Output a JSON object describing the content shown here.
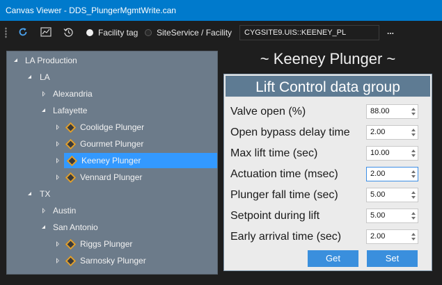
{
  "window": {
    "title": "Canvas Viewer - DDS_PlungerMgmtWrite.can"
  },
  "toolbar": {
    "refresh_icon": "refresh-icon",
    "chart_icon": "chart-icon",
    "history_icon": "history-icon",
    "radio_facility_tag": "Facility tag",
    "radio_site_service": "SiteService / Facility",
    "selected_radio": "Facility tag",
    "tag_path": "CYGSITE9.UIS::KEENEY_PL",
    "browse_label": "..."
  },
  "tree": {
    "nodes": [
      {
        "label": "LA Production",
        "expanded": true
      },
      {
        "label": "LA",
        "expanded": true
      },
      {
        "label": "Alexandria",
        "expanded": false
      },
      {
        "label": "Lafayette",
        "expanded": true
      },
      {
        "label": "Coolidge Plunger",
        "expanded": false,
        "icon": "plunger-icon"
      },
      {
        "label": "Gourmet Plunger",
        "expanded": false,
        "icon": "plunger-icon"
      },
      {
        "label": "Keeney Plunger",
        "expanded": false,
        "icon": "plunger-icon",
        "selected": true
      },
      {
        "label": "Vennard Plunger",
        "expanded": false,
        "icon": "plunger-icon"
      },
      {
        "label": "TX",
        "expanded": true
      },
      {
        "label": "Austin",
        "expanded": false
      },
      {
        "label": "San Antonio",
        "expanded": true
      },
      {
        "label": "Riggs Plunger",
        "expanded": false,
        "icon": "plunger-icon"
      },
      {
        "label": "Sarnosky Plunger",
        "expanded": false,
        "icon": "plunger-icon"
      }
    ]
  },
  "main": {
    "heading": "~ Keeney Plunger ~",
    "group_title": "Lift Control data group",
    "rows": [
      {
        "label": "Valve open (%)",
        "value": "88.00"
      },
      {
        "label": "Open bypass delay time",
        "value": "2.00"
      },
      {
        "label": "Max lift time (sec)",
        "value": "10.00"
      },
      {
        "label": "Actuation time (msec)",
        "value": "2.00",
        "focused": true
      },
      {
        "label": "Plunger fall time (sec)",
        "value": "5.00"
      },
      {
        "label": "Setpoint during lift",
        "value": "5.00"
      },
      {
        "label": "Early arrival time (sec)",
        "value": "2.00"
      }
    ],
    "get_label": "Get",
    "set_label": "Set"
  },
  "colors": {
    "title_bar": "#007acc",
    "tree_background": "#6c7b8a",
    "tree_selection": "#3399ff",
    "group_header": "#5e7b93",
    "button": "#3a8fdd",
    "plunger_icon_border": "#e0a030"
  }
}
